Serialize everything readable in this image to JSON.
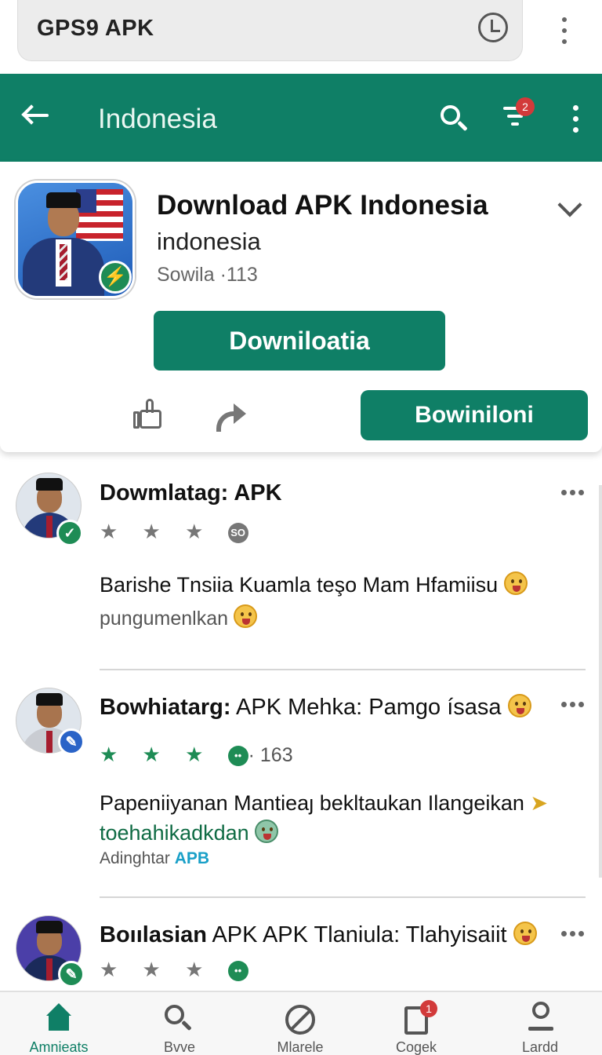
{
  "browser": {
    "url_text": "GPS9 APK",
    "clock_icon": "clock-icon",
    "menu_icon": "more-vert-icon"
  },
  "appbar": {
    "title": "Indonesia",
    "filter_badge": "2",
    "color": "#0f7f66"
  },
  "app": {
    "title": "Download APK Indonesia",
    "subtitle": "indonesia",
    "meta": "Sowila ·113",
    "primary_button": "Downiloatia",
    "secondary_button": "Bowiniloni"
  },
  "posts": [
    {
      "title_bold": "Dowmlatag: APK",
      "title_rest": "",
      "stars": "★ ★ ★",
      "chip": "SO",
      "count": "",
      "body_line1": "Barishe Tnsiia Kuamla teşo Mam Hfamiisu",
      "body_line2": "pungumenlkan",
      "body_line3": ""
    },
    {
      "title_bold": "Bowhiatarg:",
      "title_rest": "APK Mehka: Pamgo ísasa",
      "stars": "★ ★ ★",
      "chip": "••",
      "count": "· 163",
      "body_line1": "Papeniiyanan Mantieaȷ bekltaukan Ilangeikan",
      "body_line2": "toehahikadkdan",
      "body_line3_a": "Adinghtar ",
      "body_line3_b": "APB"
    },
    {
      "title_bold": "Boıılasian",
      "title_rest": "APK APK Tlaniula: Tlahyisaiit",
      "stars": "★ ★ ★",
      "chip": "••",
      "count": ""
    }
  ],
  "bottom_nav": [
    {
      "label": "Amnieats",
      "icon": "home-icon",
      "active": true
    },
    {
      "label": "Bvve",
      "icon": "search-icon",
      "active": false
    },
    {
      "label": "Mlarele",
      "icon": "block-icon",
      "active": false
    },
    {
      "label": "Cogek",
      "icon": "clipboard-icon",
      "badge": "1",
      "active": false
    },
    {
      "label": "Lardd",
      "icon": "location-icon",
      "active": false
    }
  ]
}
